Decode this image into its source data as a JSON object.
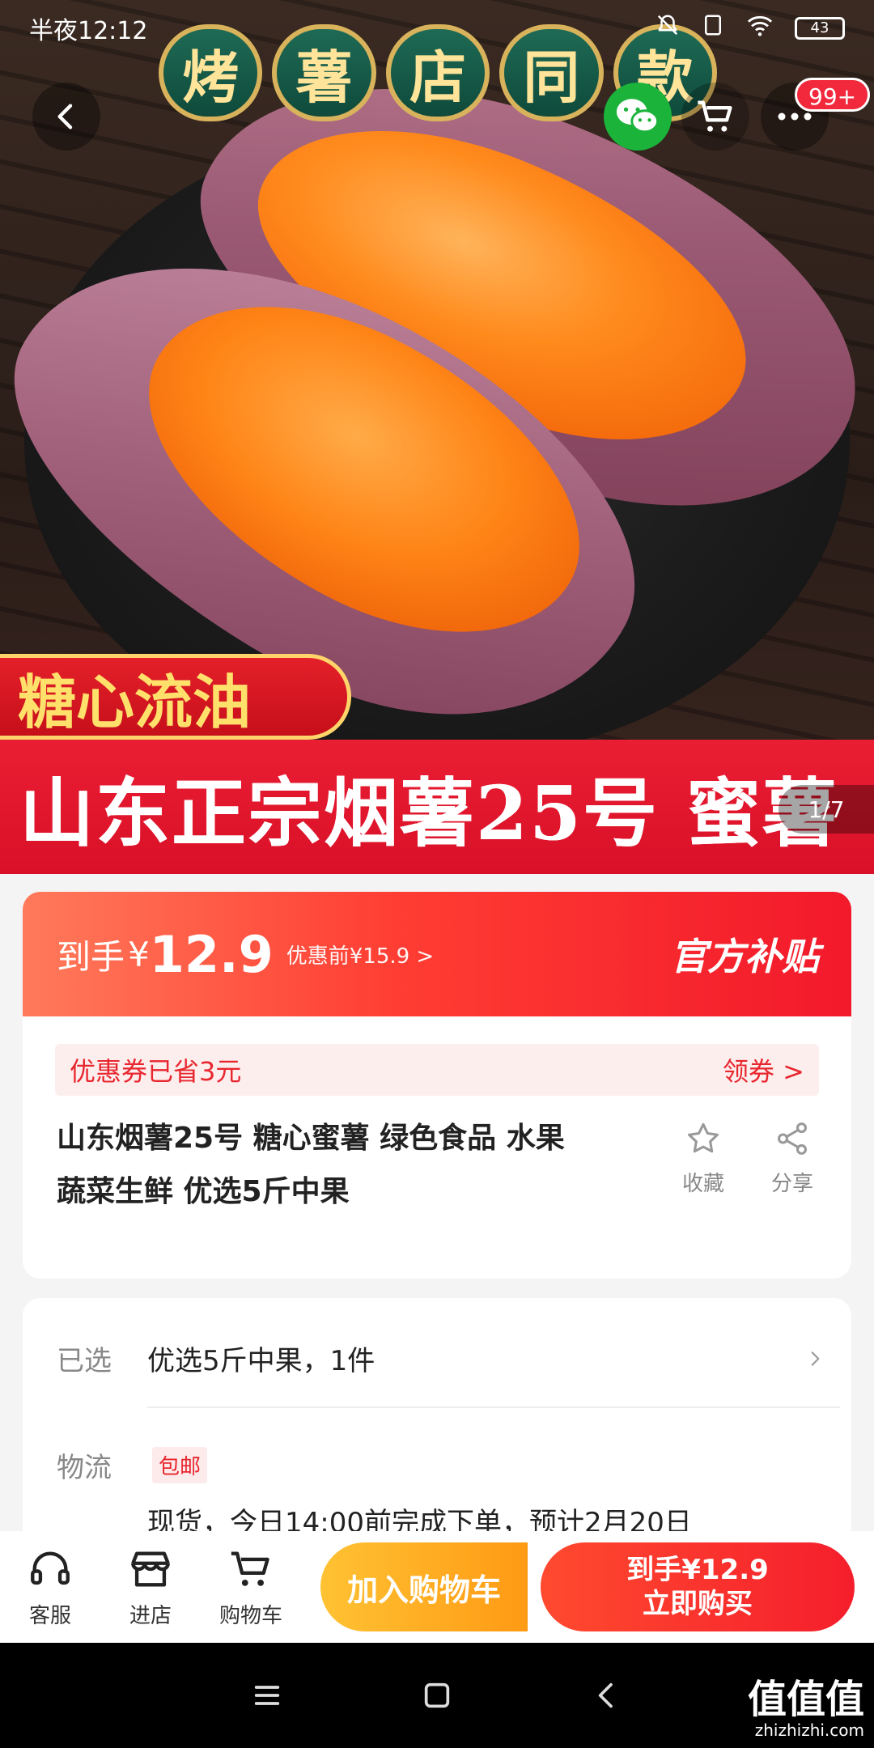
{
  "status_bar": {
    "time": "半夜12:12",
    "battery": "43"
  },
  "hero": {
    "banner_chars": [
      "烤",
      "薯",
      "店",
      "同",
      "款"
    ],
    "tag_left": "糖心流油",
    "red_band": "山东正宗烟薯25号 蜜薯",
    "counter": "1/7",
    "cart_badge": "99+"
  },
  "price_card": {
    "label": "到手",
    "currency": "¥",
    "price": "12.9",
    "original_price": "优惠前¥15.9 >",
    "official": "官方补贴",
    "coupon_text": "优惠券已省3元",
    "coupon_action": "领券 >",
    "title_line1": "山东烟薯25号 糖心蜜薯 绿色食品 水果",
    "title_line2": "蔬菜生鲜 优选5斤中果",
    "favorite_label": "收藏",
    "share_label": "分享"
  },
  "spec_card": {
    "selected_label": "已选",
    "selected_value": "优选5斤中果，1件",
    "shipping_label": "物流",
    "shipping_tag": "包邮",
    "shipping_text": "现货，今日14:00前完成下单，预计2月20日"
  },
  "bottom_bar": {
    "service_label": "客服",
    "store_label": "进店",
    "cart_label": "购物车",
    "add_cart_label": "加入购物车",
    "buy_line1": "到手¥12.9",
    "buy_line2": "立即购买"
  },
  "watermark": {
    "big": "值值值",
    "small": "zhizhizhi.com"
  }
}
